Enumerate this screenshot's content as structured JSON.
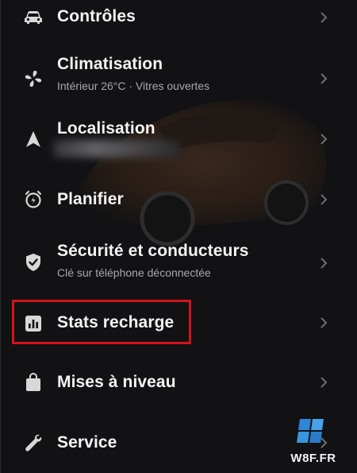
{
  "menu": {
    "items": [
      {
        "id": "controles",
        "title": "Contrôles",
        "icon": "car-icon"
      },
      {
        "id": "climatisation",
        "title": "Climatisation",
        "subtitle": "Intérieur 26°C · Vitres ouvertes",
        "icon": "fan-icon"
      },
      {
        "id": "localisation",
        "title": "Localisation",
        "icon": "location-arrow-icon"
      },
      {
        "id": "planifier",
        "title": "Planifier",
        "icon": "alarm-clock-icon"
      },
      {
        "id": "securite",
        "title": "Sécurité et conducteurs",
        "subtitle": "Clé sur téléphone déconnectée",
        "icon": "shield-check-icon"
      },
      {
        "id": "stats",
        "title": "Stats recharge",
        "icon": "bar-chart-icon"
      },
      {
        "id": "mises",
        "title": "Mises à niveau",
        "icon": "shopping-bag-icon"
      },
      {
        "id": "service",
        "title": "Service",
        "icon": "wrench-icon"
      }
    ]
  },
  "highlight_color": "#d4131b",
  "watermark": {
    "text": "W8F.FR"
  }
}
